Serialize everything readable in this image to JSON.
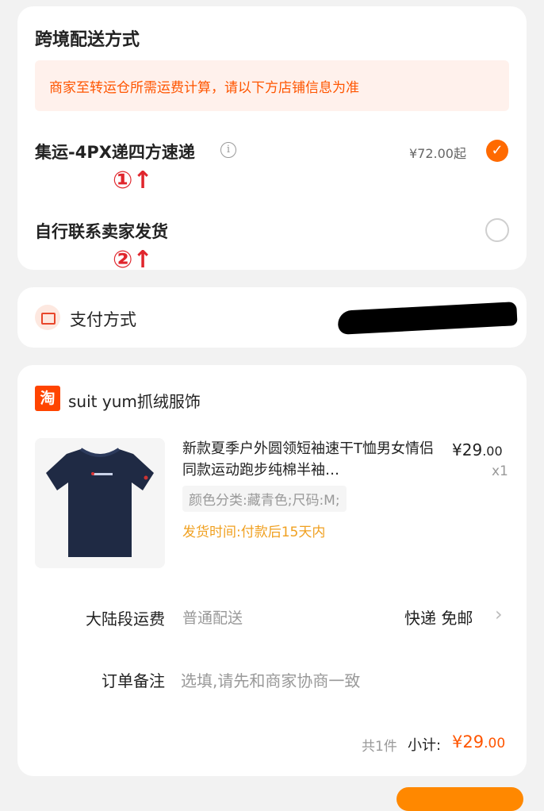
{
  "shipping": {
    "title": "跨境配送方式",
    "notice": "商家至转运仓所需运费计算，请以下方店铺信息为准",
    "options": [
      {
        "label": "集运-4PX递四方速递",
        "price": "¥72.00起",
        "selected": true
      },
      {
        "label": "自行联系卖家发货",
        "selected": false
      }
    ],
    "annotations": [
      "①↑",
      "②↑"
    ]
  },
  "payment": {
    "label": "支付方式",
    "icon": "wallet-icon"
  },
  "order": {
    "shop_logo": "淘",
    "shop_name": "suit yum抓绒服饰",
    "product": {
      "title": "新款夏季户外圆领短袖速干T恤男女情侣同款运动跑步纯棉半袖…",
      "price_int": "¥29",
      "price_dec": ".00",
      "qty": "x1",
      "sku": "颜色分类:藏青色;尺码:M;",
      "ship_time": "发货时间:付款后15天内"
    },
    "mainland_shipping": {
      "label": "大陆段运费",
      "type": "普通配送",
      "method": "快递 免邮"
    },
    "note": {
      "label": "订单备注",
      "placeholder": "选填,请先和商家协商一致"
    },
    "summary": {
      "count": "共1件",
      "subtotal_label": "小计:",
      "subtotal_int": "¥29",
      "subtotal_dec": ".00"
    }
  },
  "colors": {
    "accent": "#ff6a00",
    "price": "#ff5500",
    "annotation": "#e0262d"
  }
}
